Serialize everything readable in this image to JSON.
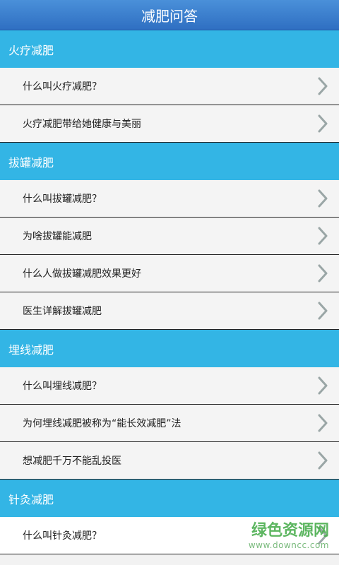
{
  "app_bar": {
    "title": "减肥问答"
  },
  "sections": [
    {
      "title": "火疗减肥",
      "items": [
        "什么叫火疗减肥？",
        "火疗减肥带给她健康与美丽"
      ]
    },
    {
      "title": "拔罐减肥",
      "items": [
        "什么叫拔罐减肥？",
        "为啥拔罐能减肥",
        "什么人做拔罐减肥效果更好",
        "医生详解拔罐减肥"
      ]
    },
    {
      "title": "埋线减肥",
      "items": [
        "什么叫埋线减肥？",
        "为何埋线减肥被称为“能长效减肥”法",
        "想减肥千万不能乱投医"
      ]
    },
    {
      "title": "针灸减肥",
      "items": [
        "什么叫针灸减肥？"
      ]
    }
  ],
  "watermark": {
    "title": "绿色资源网",
    "url": "www.downcc.com"
  },
  "icons": {
    "row_arrow": "chevron-right-icon"
  },
  "colors": {
    "app_bar": "#3a7fd0",
    "section_header": "#33b5e5",
    "watermark": "#4caf50"
  }
}
